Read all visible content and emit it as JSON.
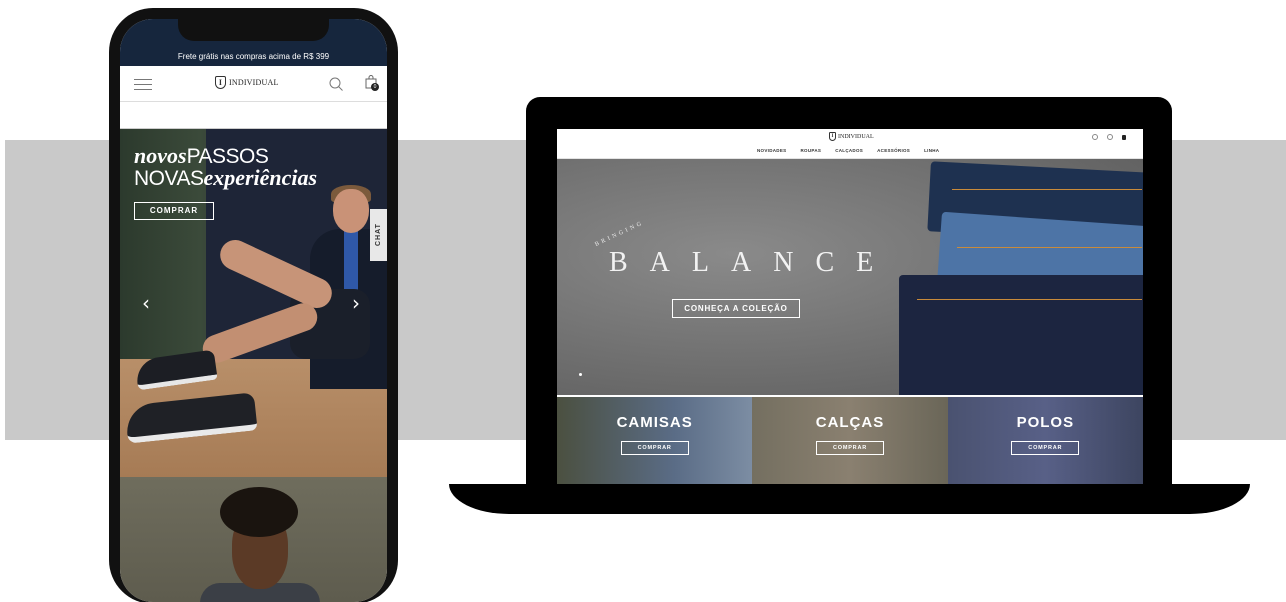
{
  "mobile": {
    "promo_bar": "Frete grátis nas compras acima de R$ 399",
    "logo_text": "INDIVIDUAL",
    "logo_mark": "I",
    "cart_count": "0",
    "hero": {
      "title_line1_italic": "novos",
      "title_line1_upper": "PASSOS",
      "title_line2_upper": "NOVAS",
      "title_line2_italic": "experiências",
      "cta": "COMPRAR",
      "prev_arrow": "‹",
      "next_arrow": "›"
    },
    "chat_tab": "CHAT",
    "icons": [
      "menu-icon",
      "search-icon",
      "shopping-bag-icon",
      "chat-icon"
    ]
  },
  "desktop": {
    "logo_text": "INDIVIDUAL",
    "logo_mark": "I",
    "nav": [
      "NOVIDADES",
      "ROUPAS",
      "CALÇADOS",
      "ACESSÓRIOS",
      "LINHA"
    ],
    "hero": {
      "kicker": "BRINGING",
      "headline": "BALANCE",
      "cta": "CONHEÇA A COLEÇÃO"
    },
    "tiles": [
      {
        "title": "CAMISAS",
        "cta": "COMPRAR"
      },
      {
        "title": "CALÇAS",
        "cta": "COMPRAR"
      },
      {
        "title": "POLOS",
        "cta": "COMPRAR"
      }
    ]
  },
  "colors": {
    "promo_bar": "#16263d",
    "band": "#c9c9c9",
    "device_frame": "#111111"
  }
}
